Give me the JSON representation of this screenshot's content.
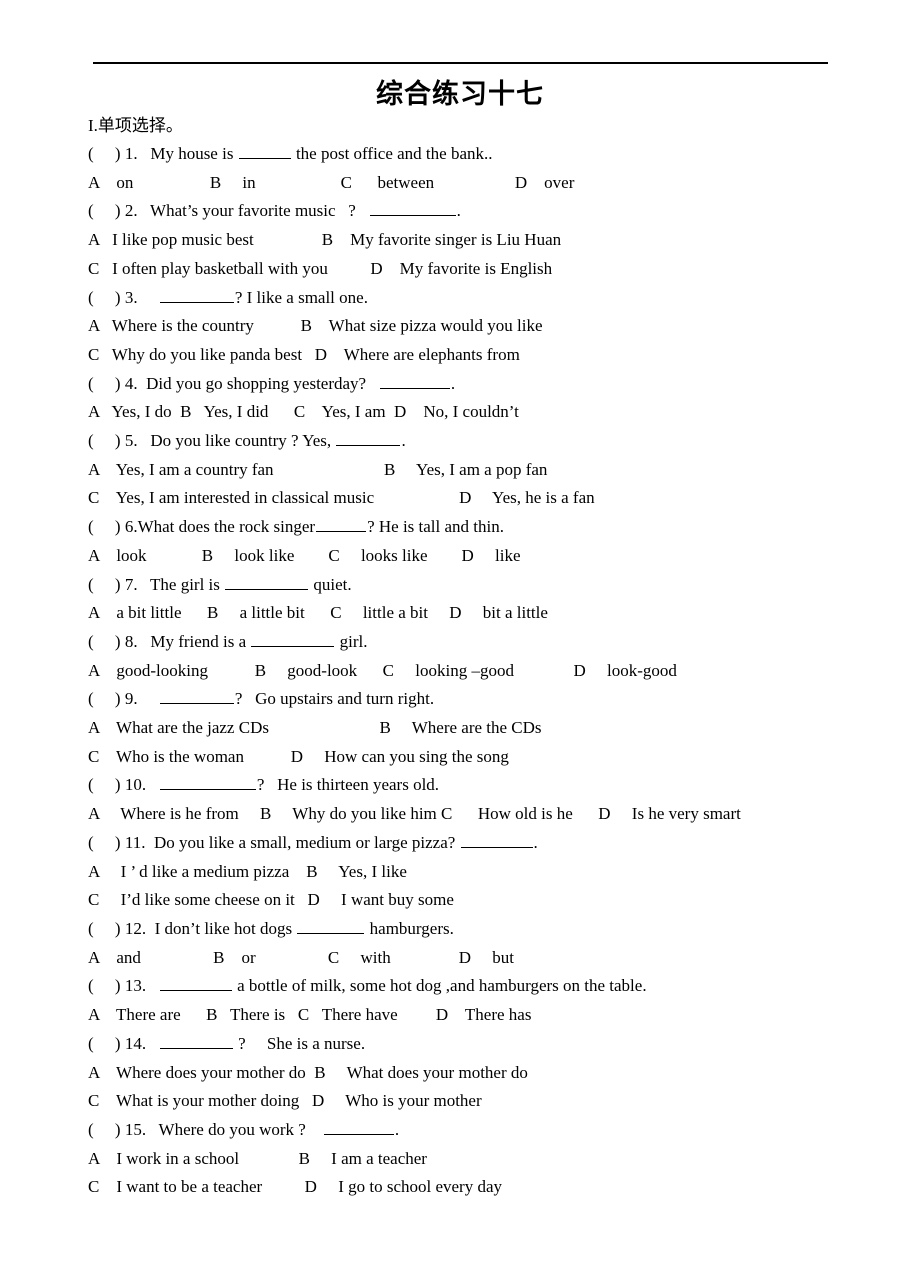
{
  "document": {
    "title": "综合练习十七",
    "section_label": "I.单项选择。",
    "rule": true
  },
  "questions": [
    {
      "marker": "(     ) 1.",
      "stem_before": "   My house is ",
      "blank_width": 52,
      "stem_after": " the post office and the bank..",
      "option_lines": [
        "A    on                  B     in                    C      between                   D    over"
      ]
    },
    {
      "marker": "(     ) 2.",
      "stem_before": "   What’s your favorite music   ?   ",
      "blank_width": 86,
      "stem_after": ".",
      "option_lines": [
        "A   I like pop music best                B    My favorite singer is Liu Huan",
        "C   I often play basketball with you          D    My favorite is English"
      ]
    },
    {
      "marker": "(     ) 3.",
      "stem_before": "     ",
      "blank_width": 74,
      "stem_after": "? I like a small one.",
      "option_lines": [
        "A   Where is the country           B    What size pizza would you like",
        "C   Why do you like panda best   D    Where are elephants from"
      ]
    },
    {
      "marker": "(     ) 4.",
      "stem_before": "  Did you go shopping yesterday?   ",
      "blank_width": 70,
      "stem_after": ".",
      "option_lines": [
        "A   Yes, I do  B   Yes, I did      C    Yes, I am  D    No, I couldn’t"
      ]
    },
    {
      "marker": "(     ) 5.",
      "stem_before": "   Do you like country ? Yes, ",
      "blank_width": 64,
      "stem_after": ".",
      "option_lines": [
        "A    Yes, I am a country fan                          B     Yes, I am a pop fan",
        "C    Yes, I am interested in classical music                    D     Yes, he is a fan"
      ]
    },
    {
      "marker": "(     ) 6.",
      "stem_before": "What does the rock singer",
      "blank_width": 50,
      "stem_after": "? He is tall and thin.",
      "option_lines": [
        "A    look             B     look like        C     looks like        D     like"
      ]
    },
    {
      "marker": "(     ) 7.",
      "stem_before": "   The girl is ",
      "blank_width": 83,
      "stem_after": " quiet.",
      "option_lines": [
        "A    a bit little      B     a little bit      C     little a bit     D     bit a little"
      ]
    },
    {
      "marker": "(     ) 8.",
      "stem_before": "   My friend is a ",
      "blank_width": 83,
      "stem_after": " girl.",
      "option_lines": [
        "A    good-looking           B     good-look      C     looking –good              D     look-good"
      ]
    },
    {
      "marker": "(     ) 9.",
      "stem_before": "     ",
      "blank_width": 74,
      "stem_after": "?   Go upstairs and turn right.",
      "option_lines": [
        "A    What are the jazz CDs                          B     Where are the CDs",
        "C    Who is the woman           D     How can you sing the song"
      ]
    },
    {
      "marker": "(     ) 10.",
      "stem_before": "   ",
      "blank_width": 96,
      "stem_after": "?   He is thirteen years old.",
      "option_lines": [
        "A     Where is he from     B     Why do you like him C      How old is he      D     Is he very smart"
      ]
    },
    {
      "marker": "(     ) 11.",
      "stem_before": "  Do you like a small, medium or large pizza? ",
      "blank_width": 72,
      "stem_after": ".",
      "option_lines": [
        "A     I ’ d like a medium pizza    B     Yes, I like",
        "C     I’d like some cheese on it   D     I want buy some"
      ]
    },
    {
      "marker": "(     ) 12.",
      "stem_before": "  I don’t like hot dogs ",
      "blank_width": 67,
      "stem_after": " hamburgers.",
      "option_lines": [
        "A    and                 B    or                 C     with                D     but"
      ]
    },
    {
      "marker": "(     ) 13.",
      "stem_before": "   ",
      "blank_width": 72,
      "stem_after": " a bottle of milk, some hot dog ,and hamburgers on the table.",
      "option_lines": [
        "A    There are      B   There is   C   There have         D    There has"
      ]
    },
    {
      "marker": "(     ) 14.",
      "stem_before": "   ",
      "blank_width": 73,
      "stem_after": " ?     She is a nurse.",
      "option_lines": [
        "A    Where does your mother do  B     What does your mother do",
        "C    What is your mother doing   D     Who is your mother"
      ]
    },
    {
      "marker": "(     ) 15.",
      "stem_before": "   Where do you work ?    ",
      "blank_width": 70,
      "stem_after": ".",
      "option_lines": [
        "A    I work in a school              B     I am a teacher",
        "C    I want to be a teacher          D     I go to school every day"
      ]
    }
  ]
}
